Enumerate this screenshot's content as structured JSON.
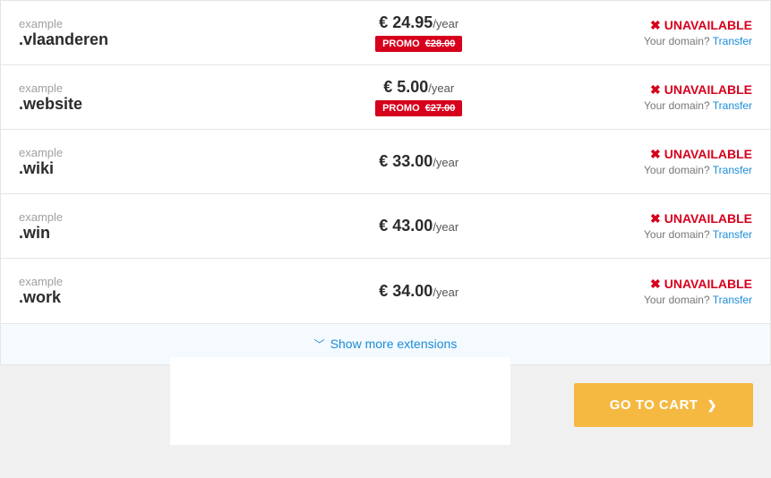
{
  "example_label": "example",
  "per_year": "/year",
  "promo_label": "PROMO",
  "unavailable_label": "UNAVAILABLE",
  "your_domain_text": "Your domain?",
  "transfer_label": "Transfer",
  "show_more_label": "Show more extensions",
  "cart_button_label": "GO TO CART",
  "rows": [
    {
      "tld": ".vlaanderen",
      "price": "€ 24.95",
      "promo_old": "€28.00"
    },
    {
      "tld": ".website",
      "price": "€ 5.00",
      "promo_old": "€27.00"
    },
    {
      "tld": ".wiki",
      "price": "€ 33.00",
      "promo_old": null
    },
    {
      "tld": ".win",
      "price": "€ 43.00",
      "promo_old": null
    },
    {
      "tld": ".work",
      "price": "€ 34.00",
      "promo_old": null
    }
  ]
}
